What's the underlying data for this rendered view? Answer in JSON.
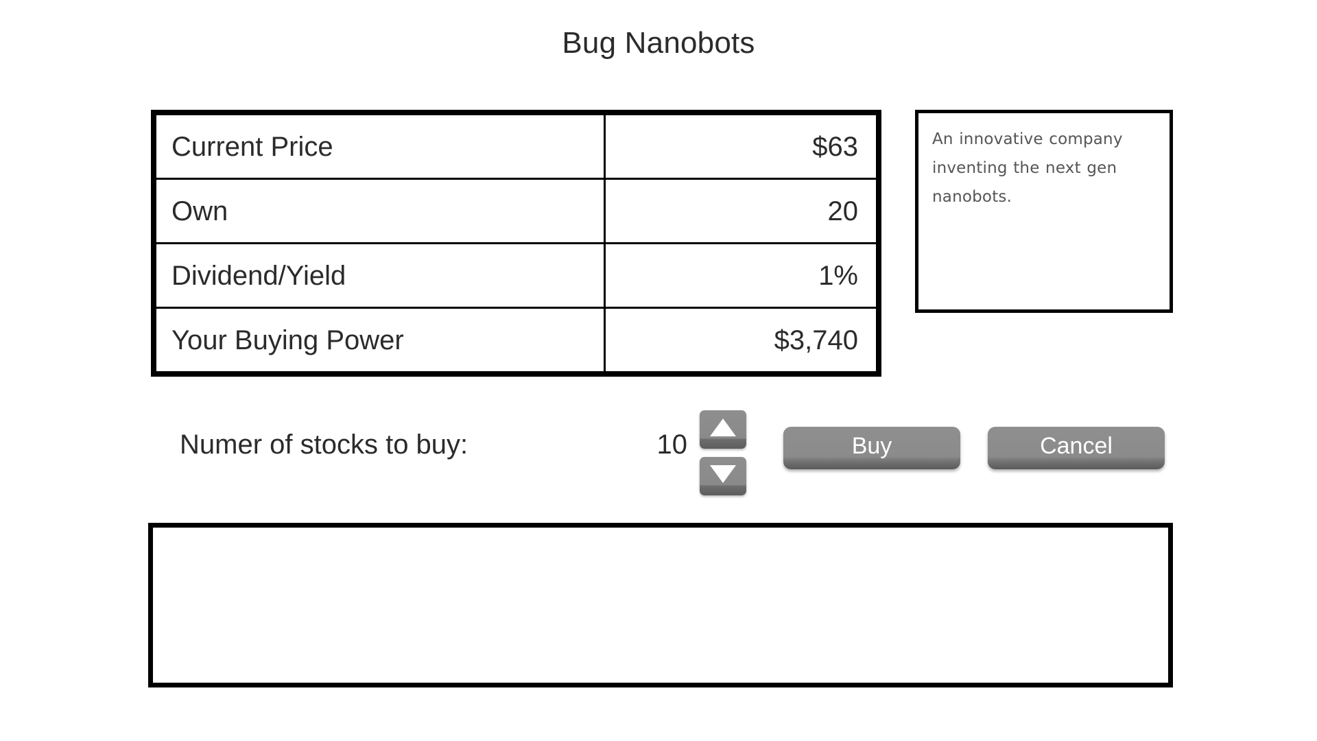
{
  "page": {
    "title": "Bug Nanobots",
    "background_color": "#ffffff",
    "text_color": "#2b2b2b"
  },
  "stats_table": {
    "rows": [
      {
        "label": "Current Price",
        "value": "$63"
      },
      {
        "label": "Own",
        "value": "20"
      },
      {
        "label": "Dividend/Yield",
        "value": "1%"
      },
      {
        "label": "Your Buying Power",
        "value": "$3,740"
      }
    ]
  },
  "description": {
    "text": "An innovative company inventing the next gen nanobots."
  },
  "controls": {
    "quantity_label": "Numer of stocks to buy:",
    "quantity_value": "10",
    "stepper": {
      "increment_icon": "triangle-up-icon",
      "decrement_icon": "triangle-down-icon"
    },
    "buy_label": "Buy",
    "cancel_label": "Cancel",
    "button_color": "#8b8b8b",
    "button_text_color": "#ffffff"
  },
  "log": {
    "message": ""
  }
}
